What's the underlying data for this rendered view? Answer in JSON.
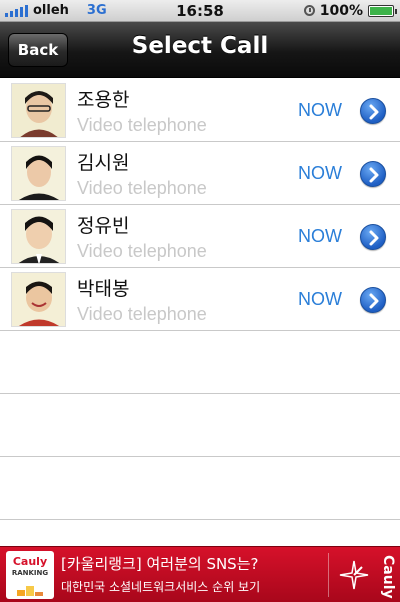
{
  "status_bar": {
    "carrier": "olleh",
    "network": "3G",
    "time": "16:58",
    "battery": "100%"
  },
  "nav": {
    "back_label": "Back",
    "title": "Select Call"
  },
  "contacts": [
    {
      "name": "조용한",
      "subtitle": "Video telephone",
      "status": "NOW"
    },
    {
      "name": "김시원",
      "subtitle": "Video telephone",
      "status": "NOW"
    },
    {
      "name": "정유빈",
      "subtitle": "Video telephone",
      "status": "NOW"
    },
    {
      "name": "박태봉",
      "subtitle": "Video telephone",
      "status": "NOW"
    }
  ],
  "ad": {
    "logo_brand": "Cauly",
    "logo_sub": "RANKING",
    "title": "[카울리랭크] 여러분의 SNS는?",
    "description": "대한민국 소셜네트워크서비스 순위 보기",
    "side_brand": "Cauly"
  },
  "colors": {
    "accent_blue": "#2a7ed8",
    "ad_red": "#d6112a"
  }
}
